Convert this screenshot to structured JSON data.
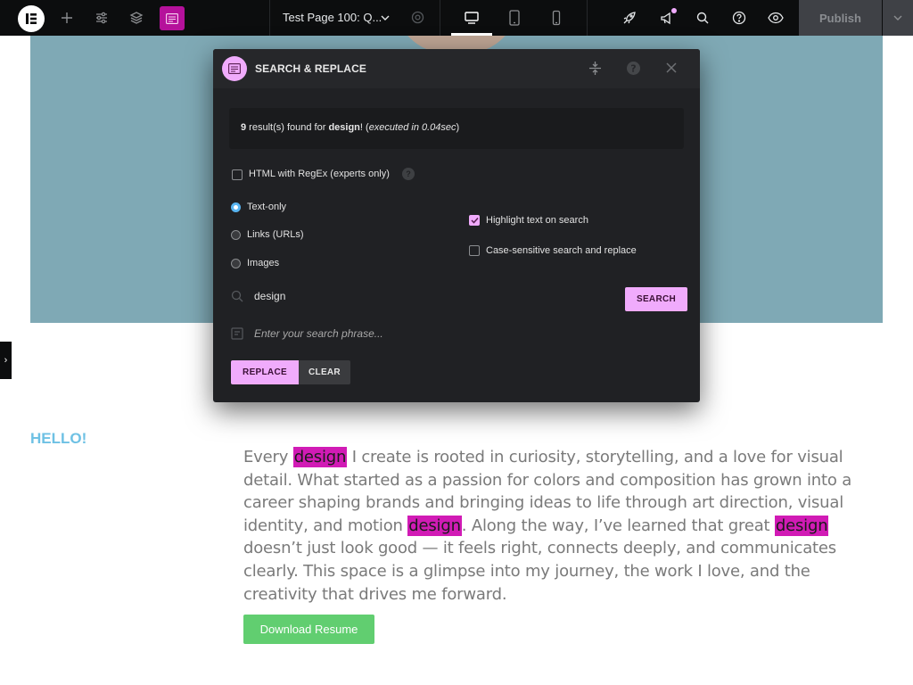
{
  "topbar": {
    "page_title": "Test Page 100: Q...",
    "publish_label": "Publish",
    "accent": "#b5119b"
  },
  "canvas": {
    "hero_color": "#7fa9b5",
    "panel_toggle": "›",
    "heading": "HELLO!",
    "paragraph": [
      {
        "text": "Every ",
        "highlight": false
      },
      {
        "text": "design",
        "highlight": true
      },
      {
        "text": " I create is rooted in curiosity, storytelling, and a love for visual detail. What started as a passion for colors and composition has grown into a career shaping brands and bringing ideas to life through art direction, visual identity, and motion ",
        "highlight": false
      },
      {
        "text": "design",
        "highlight": true
      },
      {
        "text": ". Along the way, I’ve learned that great ",
        "highlight": false
      },
      {
        "text": "design",
        "highlight": true
      },
      {
        "text": " doesn’t just look good — it feels right, connects deeply, and communicates clearly. This space is a glimpse into my journey, the work I love, and the creativity that drives me forward.",
        "highlight": false
      }
    ],
    "highlight_color": "#d11bb5",
    "download_label": "Download Resume"
  },
  "modal": {
    "title": "SEARCH & REPLACE",
    "result": {
      "count": "9",
      "mid": " result(s) found for ",
      "term": "design",
      "after": "! (",
      "executed": "executed in 0.04sec",
      "close": ")"
    },
    "html_regex_label": "HTML with RegEx (experts only)",
    "help_glyph": "?",
    "modes": [
      {
        "label": "Text-only",
        "checked": true
      },
      {
        "label": "Links (URLs)",
        "checked": false
      },
      {
        "label": "Images",
        "checked": false
      }
    ],
    "highlight_label": "Highlight text on search",
    "highlight_checked": true,
    "case_label": "Case-sensitive search and replace",
    "case_checked": false,
    "search_value": "design",
    "replace_placeholder": "Enter your search phrase...",
    "search_button": "SEARCH",
    "replace_button": "REPLACE",
    "clear_button": "CLEAR",
    "accent": "#f0abfc"
  }
}
